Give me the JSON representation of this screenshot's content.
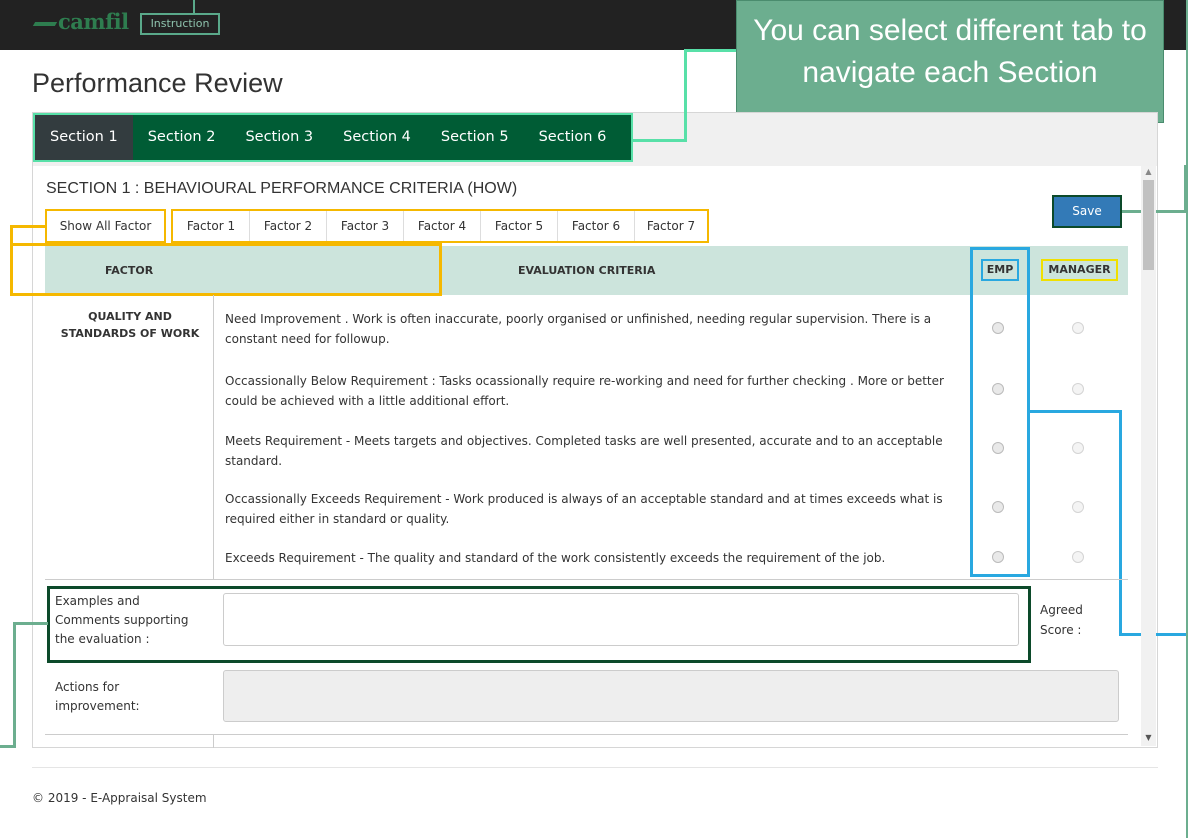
{
  "brand": {
    "logo_text": "camfil",
    "instruction_label": "Instruction"
  },
  "callout": {
    "text": "You can select different tab to navigate each Section"
  },
  "page": {
    "title": "Performance Review"
  },
  "tabs": [
    {
      "label": "Section 1",
      "active": true
    },
    {
      "label": "Section 2",
      "active": false
    },
    {
      "label": "Section 3",
      "active": false
    },
    {
      "label": "Section 4",
      "active": false
    },
    {
      "label": "Section 5",
      "active": false
    },
    {
      "label": "Section 6",
      "active": false
    }
  ],
  "section": {
    "title": "SECTION 1 : BEHAVIOURAL PERFORMANCE CRITERIA (HOW)"
  },
  "filters": {
    "show_all": "Show All Factor",
    "factors": [
      "Factor 1",
      "Factor 2",
      "Factor 3",
      "Factor 4",
      "Factor 5",
      "Factor 6",
      "Factor 7"
    ]
  },
  "toolbar": {
    "save_label": "Save"
  },
  "table": {
    "headers": {
      "factor": "FACTOR",
      "evaluation": "EVALUATION CRITERIA",
      "emp": "EMP",
      "manager": "MANAGER"
    },
    "factor_name": "QUALITY AND STANDARDS OF WORK",
    "criteria": [
      "Need Improvement . Work is often inaccurate, poorly organised or unfinished, needing regular supervision. There is a constant need for followup.",
      "Occassionally Below Requirement : Tasks ocassionally require re-working and need for further checking . More or better could be achieved with a little additional effort.",
      "Meets Requirement - Meets targets and objectives. Completed tasks are well presented, accurate and to an acceptable standard.",
      "Occassionally Exceeds Requirement - Work produced is always of an acceptable standard and at times exceeds what is required either in standard or quality.",
      "Exceeds Requirement - The quality and standard of the work consistently exceeds the requirement of the job."
    ]
  },
  "form": {
    "comments_label": "Examples and Comments supporting the evaluation :",
    "comments_value": "",
    "agreed_label": "Agreed Score :",
    "actions_label": "Actions for improvement:",
    "actions_value": ""
  },
  "footer": {
    "text": "© 2019 - E-Appraisal System"
  },
  "colors": {
    "topbar": "#222222",
    "tab_bg": "#005c35",
    "tab_active": "#333c3f",
    "callout_bg": "#6cae8f",
    "save_button": "#337ab7",
    "table_header": "#cce4dc"
  }
}
